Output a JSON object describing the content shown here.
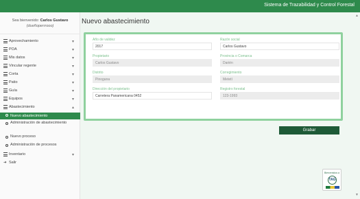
{
  "header": {
    "title": "Sistema de Trazabilidad y Control Forestal"
  },
  "sidebar": {
    "welcome_prefix": "Sea bienvenido:",
    "user_name": "Carlos Gustavo",
    "user_handle": "(dueñoperrrooo)",
    "nav": [
      {
        "label": "Aprovechamiento",
        "icon": "menu-icon"
      },
      {
        "label": "POA",
        "icon": "menu-icon"
      },
      {
        "label": "Mis datos",
        "icon": "menu-icon"
      },
      {
        "label": "Vincular regente",
        "icon": "menu-icon"
      },
      {
        "label": "Corta",
        "icon": "menu-icon"
      },
      {
        "label": "Patio",
        "icon": "menu-icon"
      },
      {
        "label": "Guía",
        "icon": "menu-icon"
      },
      {
        "label": "Equipos",
        "icon": "menu-icon"
      },
      {
        "label": "Abastecimiento",
        "icon": "menu-icon"
      }
    ],
    "sub": [
      {
        "label": "Nuevo abastecimiento"
      },
      {
        "label": "Administración de abastecimiento"
      },
      {
        "label": "Nuevo proceso"
      },
      {
        "label": "Administración de procesos"
      }
    ],
    "inventario": "Inventario",
    "salir": "Salir"
  },
  "main": {
    "title": "Nuevo abastecimiento",
    "fields": {
      "anio": {
        "label": "Año de validez",
        "value": "2017"
      },
      "razon": {
        "label": "Razón social",
        "value": "Carlos Gustavo"
      },
      "propietario": {
        "label": "Propietario",
        "value": "Carlos Gustavo"
      },
      "provincia": {
        "label": "Provincia o Comarca",
        "value": "Darién"
      },
      "distrito": {
        "label": "Distrito",
        "value": "Pinogana"
      },
      "corregimiento": {
        "label": "Corregimiento",
        "value": "Metetí"
      },
      "direccion": {
        "label": "Dirección del propietario",
        "value": "Carretera Panamericana 0452"
      },
      "registro": {
        "label": "Registro forestal",
        "value": "123-1993"
      }
    },
    "save_label": "Grabar"
  },
  "badge": {
    "text": "Bienvenidos a",
    "logo": "TAG"
  },
  "colors": {
    "primary": "#2e8a4c",
    "dark_button": "#1e5a37",
    "panel_border": "#8fd19e"
  }
}
